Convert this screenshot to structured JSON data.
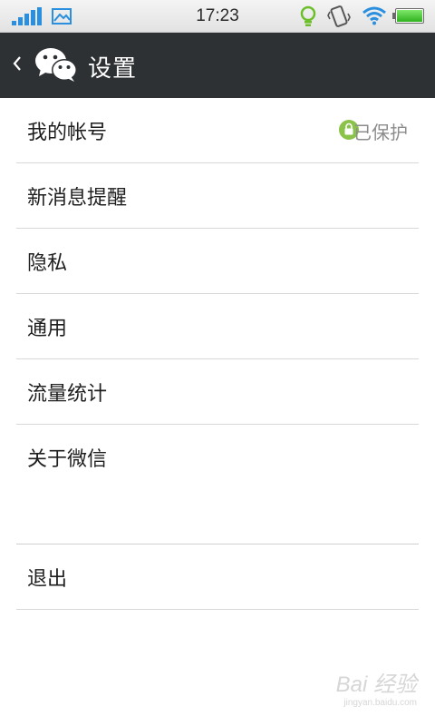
{
  "status_bar": {
    "time": "17:23",
    "icons": [
      "signal-icon",
      "image-icon",
      "lightbulb-icon",
      "vibrate-icon",
      "wifi-icon",
      "battery-icon"
    ],
    "battery_level": 1.0,
    "accent_color": "#2a8fde"
  },
  "header": {
    "title": "设置",
    "back_icon": "chevron-left-icon",
    "app_icon": "wechat-icon",
    "background_color": "#2e3134"
  },
  "settings": {
    "items": [
      {
        "label": "我的帐号",
        "status": "已保护",
        "status_icon": "lock-icon"
      },
      {
        "label": "新消息提醒"
      },
      {
        "label": "隐私"
      },
      {
        "label": "通用"
      },
      {
        "label": "流量统计"
      },
      {
        "label": "关于微信"
      }
    ],
    "logout_label": "退出"
  },
  "watermark": {
    "text": "Bai 经验",
    "subtext": "jingyan.baidu.com"
  }
}
